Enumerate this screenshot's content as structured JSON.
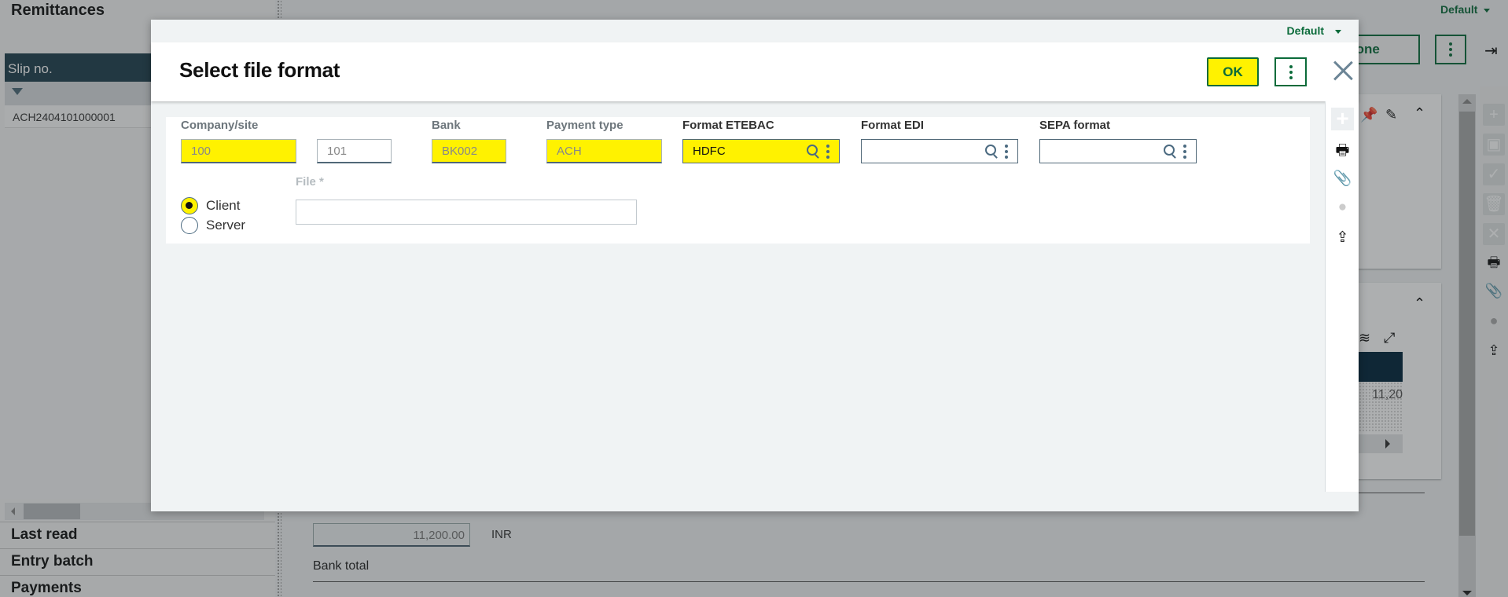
{
  "background": {
    "title": "Remittances",
    "slip_list": {
      "column_header": "Slip no.",
      "rows": [
        "ACH2404101000001"
      ]
    },
    "sections": [
      "Last read",
      "Entry batch",
      "Payments"
    ],
    "amount_field": "11,200.00",
    "currency": "INR",
    "bank_total_label": "Bank total",
    "grid_value": "11,20",
    "top_default": "Default",
    "milestone_button": "estone",
    "icons": {
      "pin": "pin-icon",
      "edit": "pencil-icon",
      "collapse": "chevron-up-icon",
      "layers": "layers-icon",
      "expand": "expand-icon",
      "logout": "logout-icon"
    },
    "right_toolbar": [
      "plus-icon",
      "save-icon",
      "check-icon",
      "trash-icon",
      "close-icon",
      "print-icon",
      "paperclip-icon",
      "comment-icon",
      "share-icon"
    ]
  },
  "dialog": {
    "preset": "Default",
    "title": "Select file format",
    "ok_label": "OK",
    "fields": {
      "company_site": {
        "label": "Company/site",
        "value": "100"
      },
      "site2": {
        "label": "",
        "value": "101"
      },
      "bank": {
        "label": "Bank",
        "value": "BK002"
      },
      "payment_type": {
        "label": "Payment type",
        "value": "ACH"
      },
      "format_etebac": {
        "label": "Format ETEBAC",
        "value": "HDFC"
      },
      "format_edi": {
        "label": "Format EDI",
        "value": ""
      },
      "sepa_format": {
        "label": "SEPA format",
        "value": ""
      },
      "file": {
        "label": "File",
        "required_mark": "*",
        "value": ""
      }
    },
    "location_options": [
      {
        "label": "Client",
        "selected": true
      },
      {
        "label": "Server",
        "selected": false
      }
    ],
    "toolbar": [
      "plus-icon",
      "print-icon",
      "paperclip-icon",
      "comment-icon",
      "share-icon"
    ]
  },
  "colors": {
    "accent_green": "#0b6b3a",
    "mandatory_yellow": "#fff200",
    "grid_header": "#203f4e"
  }
}
